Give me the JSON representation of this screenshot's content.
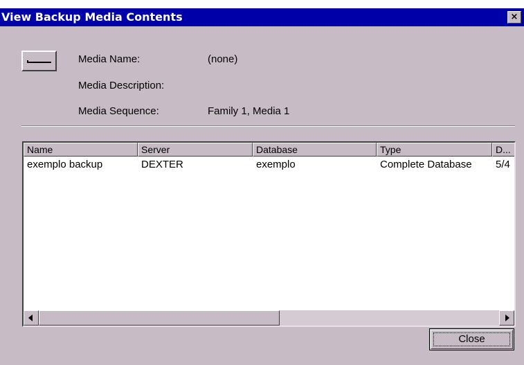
{
  "window": {
    "title": "View Backup Media Contents",
    "close_glyph": "×",
    "close_icon": "close-icon",
    "title_color": "#0000a8",
    "face_color": "#c7bcc5"
  },
  "media": {
    "icon": "tape-drive-icon",
    "name_label": "Media Name:",
    "name_value": "(none)",
    "description_label": "Media Description:",
    "description_value": "",
    "sequence_label": "Media Sequence:",
    "sequence_value": "Family 1, Media 1"
  },
  "table": {
    "columns": [
      "Name",
      "Server",
      "Database",
      "Type",
      "D..."
    ],
    "rows": [
      [
        "exemplo backup",
        "DEXTER",
        "exemplo",
        "Complete Database",
        "5/4"
      ]
    ]
  },
  "scrollbar": {
    "left_icon": "scroll-left-icon",
    "right_icon": "scroll-right-icon"
  },
  "buttons": {
    "close_label": "Close"
  }
}
